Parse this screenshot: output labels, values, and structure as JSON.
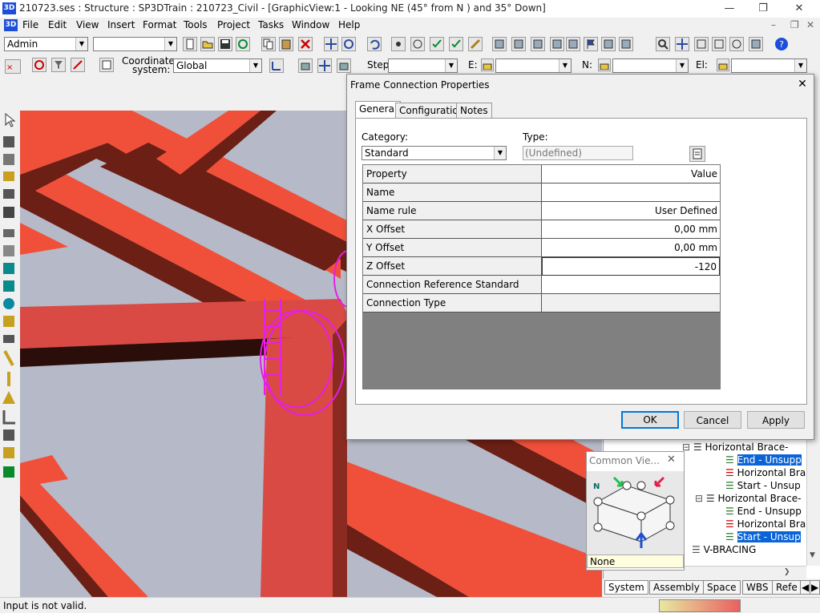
{
  "window": {
    "title": "210723.ses : Structure : SP3DTrain : 210723_Civil - [GraphicView:1 - Looking NE (45° from N ) and 35° Down]",
    "app_icon": "3D"
  },
  "menu": {
    "items": [
      "File",
      "Edit",
      "View",
      "Insert",
      "Format",
      "Tools",
      "Project",
      "Tasks",
      "Window",
      "Help"
    ]
  },
  "toolbar": {
    "role_value": "Admin",
    "second_combo_value": "",
    "coordinate_label_1": "Coordinate",
    "coordinate_label_2": "system:",
    "coordinate_value": "Global",
    "step_label": "Step:",
    "step_value": "",
    "e_label": "E:",
    "n_label": "N:",
    "el_label": "El:"
  },
  "dialog": {
    "title": "Frame Connection Properties",
    "tabs": [
      "General",
      "Configuration",
      "Notes"
    ],
    "active_tab": "General",
    "category_label": "Category:",
    "category_value": "Standard",
    "type_label": "Type:",
    "type_value": "(Undefined)",
    "grid": {
      "header_property": "Property",
      "header_value": "Value",
      "rows": [
        {
          "property": "Name",
          "value": ""
        },
        {
          "property": "Name rule",
          "value": "User Defined"
        },
        {
          "property": "X Offset",
          "value": "0,00 mm"
        },
        {
          "property": "Y Offset",
          "value": "0,00 mm"
        },
        {
          "property": "Z Offset",
          "value": "-120"
        },
        {
          "property": "Connection Reference Standard",
          "value": ""
        },
        {
          "property": "Connection Type",
          "value": ""
        }
      ]
    },
    "buttons": {
      "ok": "OK",
      "cancel": "Cancel",
      "apply": "Apply"
    }
  },
  "common_views": {
    "title": "Common Vie...",
    "north_label": "N",
    "selection": "None"
  },
  "tree": {
    "items": [
      {
        "label": "Horizontal Brace-",
        "selected": false
      },
      {
        "label": "End - Unsupp",
        "selected": true
      },
      {
        "label": "Horizontal Bra",
        "selected": false
      },
      {
        "label": "Start - Unsup",
        "selected": false
      },
      {
        "label": "Horizontal Brace-",
        "selected": false
      },
      {
        "label": "End - Unsupp",
        "selected": false
      },
      {
        "label": "Horizontal Bra",
        "selected": false
      },
      {
        "label": "Start - Unsup",
        "selected": true
      },
      {
        "label": "V-BRACING",
        "selected": false
      }
    ]
  },
  "workspace_tabs": [
    "System",
    "Assembly",
    "Space",
    "WBS",
    "Refe"
  ],
  "status": {
    "message": "Input is not valid."
  },
  "colors": {
    "beam": "#f0503a",
    "beam_dark": "#6b1f15",
    "selection": "#e61ee6",
    "viewport_bg": "#b6bac8",
    "highlight": "#0a64d8"
  }
}
